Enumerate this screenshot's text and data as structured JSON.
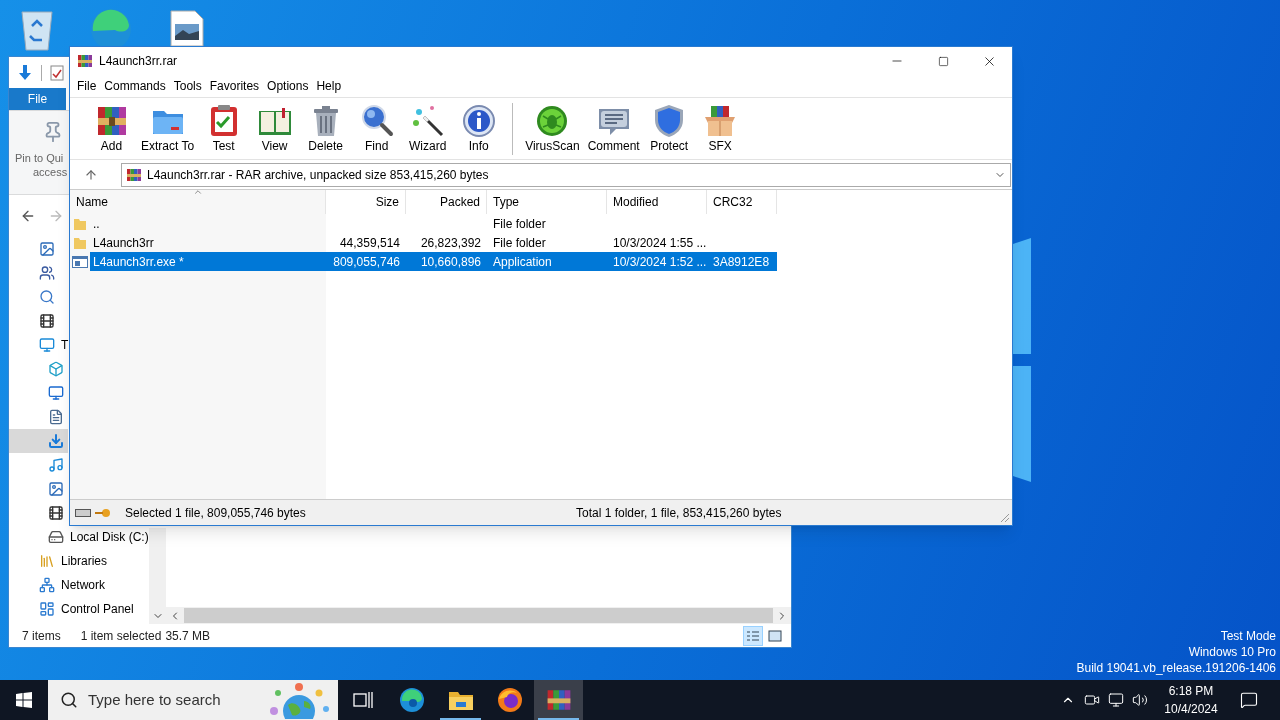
{
  "desktop": {
    "os_notice": [
      "Test Mode",
      "Windows 10 Pro",
      "Build 19041.vb_release.191206-1406"
    ]
  },
  "explorer": {
    "ribbon_tab": "File",
    "pin_label": [
      "Pin to Qui",
      "access"
    ],
    "nav_items": [
      {
        "kind": "pictures",
        "selected": false
      },
      {
        "kind": "apps",
        "selected": false
      },
      {
        "kind": "search",
        "selected": false
      },
      {
        "kind": "video",
        "selected": false
      },
      {
        "kind": "computer",
        "label": "T",
        "selected": false,
        "children": [
          {
            "kind": "objects3d",
            "selected": false
          },
          {
            "kind": "desktop",
            "selected": false
          },
          {
            "kind": "documents",
            "selected": false
          },
          {
            "kind": "downloads",
            "selected": true
          },
          {
            "kind": "music",
            "selected": false
          },
          {
            "kind": "pictures",
            "selected": false
          },
          {
            "kind": "video",
            "selected": false
          },
          {
            "kind": "disk",
            "label": "Local Disk (C:)",
            "selected": false
          }
        ]
      },
      {
        "kind": "libraries",
        "label": "Libraries",
        "selected": false
      },
      {
        "kind": "network",
        "label": "Network",
        "selected": false
      },
      {
        "kind": "control-panel",
        "label": "Control Panel",
        "selected": false
      }
    ],
    "status": {
      "count": "7 items",
      "selection": "1 item selected",
      "size": "35.7 MB"
    },
    "views": [
      {
        "kind": "details",
        "selected": true
      },
      {
        "kind": "large-icons",
        "selected": false
      }
    ]
  },
  "winrar": {
    "title": "L4aunch3rr.rar",
    "menu": [
      "File",
      "Commands",
      "Tools",
      "Favorites",
      "Options",
      "Help"
    ],
    "toolbar": [
      {
        "kind": "add",
        "label": "Add"
      },
      {
        "kind": "extract",
        "label": "Extract To"
      },
      {
        "kind": "test",
        "label": "Test"
      },
      {
        "kind": "view",
        "label": "View"
      },
      {
        "kind": "delete",
        "label": "Delete"
      },
      {
        "kind": "find",
        "label": "Find"
      },
      {
        "kind": "wizard",
        "label": "Wizard"
      },
      {
        "kind": "info",
        "label": "Info"
      },
      {
        "kind": "separator"
      },
      {
        "kind": "virusscan",
        "label": "VirusScan"
      },
      {
        "kind": "comment",
        "label": "Comment"
      },
      {
        "kind": "protect",
        "label": "Protect"
      },
      {
        "kind": "sfx",
        "label": "SFX"
      }
    ],
    "address": "L4aunch3rr.rar - RAR archive, unpacked size 853,415,260 bytes",
    "columns": [
      {
        "label": "Name",
        "sorted": true
      },
      {
        "label": "Size",
        "sorted": false
      },
      {
        "label": "Packed",
        "sorted": false
      },
      {
        "label": "Type",
        "sorted": false
      },
      {
        "label": "Modified",
        "sorted": false
      },
      {
        "label": "CRC32",
        "sorted": false
      }
    ],
    "rows": [
      {
        "kind": "folder",
        "selected": false,
        "name": "..",
        "type": "File folder"
      },
      {
        "kind": "folder",
        "selected": false,
        "name": "L4aunch3rr",
        "size": "44,359,514",
        "packed": "26,823,392",
        "type": "File folder",
        "modified": "10/3/2024 1:55 ..."
      },
      {
        "kind": "exe",
        "selected": true,
        "name": "L4aunch3rr.exe *",
        "size": "809,055,746",
        "packed": "10,660,896",
        "type": "Application",
        "modified": "10/3/2024 1:52 ...",
        "crc32": "3A8912E8"
      }
    ],
    "status_left": "Selected 1 file, 809,055,746 bytes",
    "status_right": "Total 1 folder, 1 file, 853,415,260 bytes"
  },
  "taskbar": {
    "search_placeholder": "Type here to search",
    "apps": [
      {
        "kind": "task-view",
        "running": false,
        "active": false
      },
      {
        "kind": "edge",
        "running": false,
        "active": false
      },
      {
        "kind": "explorer",
        "running": true,
        "active": false
      },
      {
        "kind": "firefox",
        "running": false,
        "active": false
      },
      {
        "kind": "winrar",
        "running": true,
        "active": true
      }
    ],
    "time": "6:18 PM",
    "date": "10/4/2024"
  }
}
